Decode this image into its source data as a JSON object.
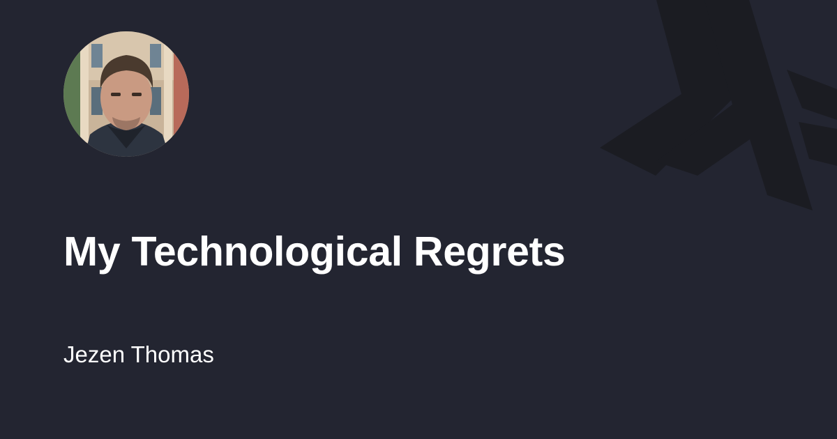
{
  "card": {
    "title": "My Technological Regrets",
    "author": "Jezen Thomas"
  },
  "icons": {
    "logo": "haskell-logo-icon",
    "avatar": "author-photo"
  },
  "colors": {
    "background": "#232531",
    "logo": "#1b1c22",
    "text": "#ffffff"
  }
}
